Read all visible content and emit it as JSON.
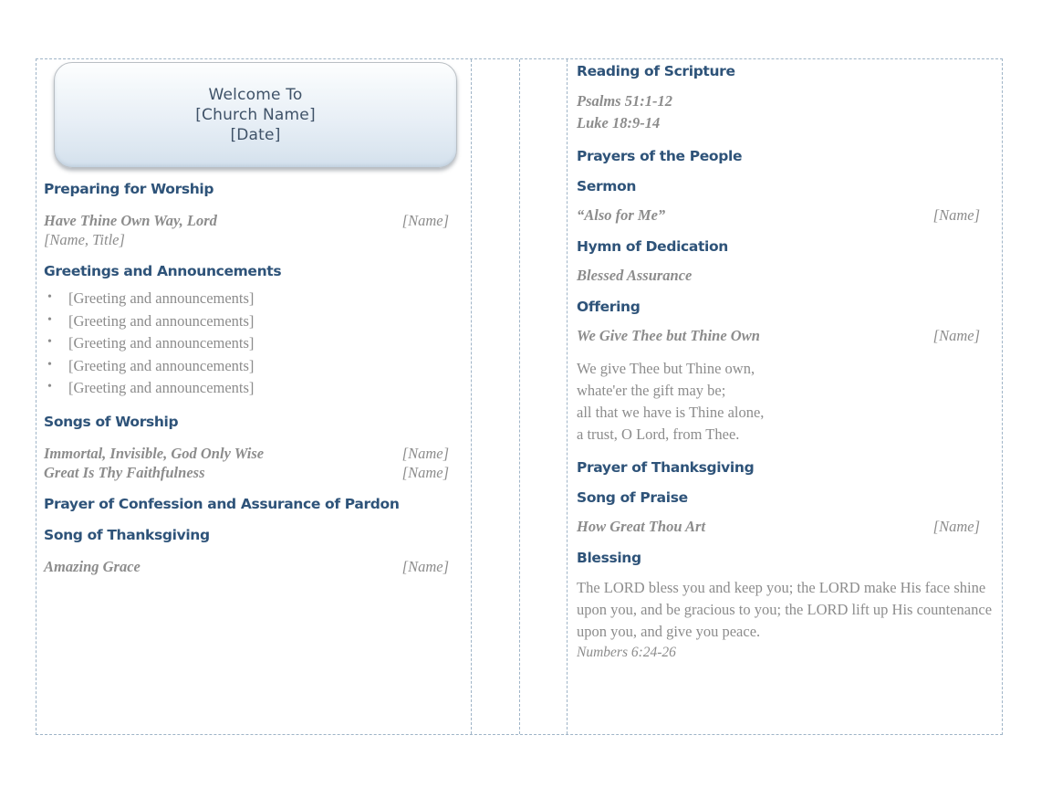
{
  "document": {
    "title": "Church Bulletin"
  },
  "banner": {
    "line1": "Welcome To",
    "line2": "[Church Name]",
    "line3": "[Date]",
    "accent_color": "#3f5268",
    "gradient_from": "#fdfefe",
    "gradient_to": "#d3e0ec"
  },
  "theme": {
    "heading_color": "#2e5379",
    "body_color": "#8c8c8c",
    "border_color": "#9fb4c7"
  },
  "left_column": {
    "preparing": {
      "heading": "Preparing for Worship",
      "song_title": "Have Thine Own Way, Lord",
      "song_name": "[Name]",
      "byline": "[Name, Title]"
    },
    "greetings": {
      "heading": "Greetings and Announcements",
      "items": [
        "[Greeting and announcements]",
        "[Greeting and announcements]",
        "[Greeting and announcements]",
        "[Greeting and announcements]",
        "[Greeting and announcements]"
      ]
    },
    "songs_of_worship": {
      "heading": "Songs of Worship",
      "songs": [
        {
          "title": "Immortal, Invisible, God Only Wise",
          "name": "[Name]"
        },
        {
          "title": "Great Is Thy Faithfulness",
          "name": "[Name]"
        }
      ]
    },
    "confession": {
      "heading": "Prayer of Confession and Assurance of Pardon"
    },
    "song_of_thanksgiving": {
      "heading": "Song of Thanksgiving",
      "song_title": "Amazing Grace",
      "song_name": "[Name]"
    }
  },
  "right_column": {
    "reading": {
      "heading": "Reading of Scripture",
      "references": [
        "Psalms 51:1-12",
        "Luke 18:9-14"
      ]
    },
    "prayers": {
      "heading": "Prayers of the People"
    },
    "sermon": {
      "heading": "Sermon",
      "title": "“Also for Me”",
      "name": "[Name]"
    },
    "hymn_of_dedication": {
      "heading": "Hymn of Dedication",
      "song_title": "Blessed Assurance"
    },
    "offering": {
      "heading": "Offering",
      "song_title": "We Give Thee but Thine Own",
      "song_name": "[Name]",
      "verse_lines": [
        "We give Thee but Thine own,",
        "whate'er the gift may be;",
        "all that we have is Thine alone,",
        "a trust, O Lord, from Thee."
      ]
    },
    "prayer_of_thanksgiving": {
      "heading": "Prayer of Thanksgiving"
    },
    "song_of_praise": {
      "heading": "Song of Praise",
      "song_title": "How Great Thou Art",
      "song_name": "[Name]"
    },
    "blessing": {
      "heading": "Blessing",
      "text": "The LORD bless you and keep you; the LORD make His face shine upon you, and be gracious to you; the LORD lift up His countenance upon you, and give you peace.",
      "reference": " Numbers 6:24-26"
    }
  }
}
